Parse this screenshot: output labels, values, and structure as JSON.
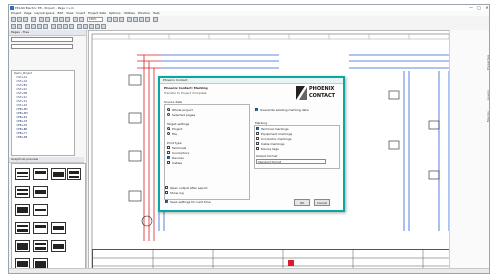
{
  "window": {
    "title": "EPLAN Electric P8 - Project - Page =+/1",
    "buttons": [
      "—",
      "□",
      "✕"
    ]
  },
  "menu": [
    "Project",
    "Page",
    "Layout space",
    "Edit",
    "View",
    "Insert",
    "Project data",
    "Options",
    "Utilities",
    "Window",
    "Help"
  ],
  "toolbar": {
    "zoom_value": "100%"
  },
  "page_navigator": {
    "title": "Pages - Tree",
    "items": [
      "Demo_Project",
      "=ST+A1",
      "=ST+A2",
      "=ST+B1",
      "=ST+K1",
      "=ST+M1",
      "=ST+S1",
      "=ST+X1",
      "=ST+X2",
      "=EB+M2",
      "=EB+M3",
      "=EB+K4",
      "=EB+X3",
      "=EB+A5",
      "=EB+B6",
      "=EB+Y7",
      "=EB+Z8"
    ]
  },
  "graphical_preview": {
    "title": "Graphical preview"
  },
  "dialog": {
    "title": "Phoenix Contact",
    "heading": "Phoenix Contact: Marking",
    "subheading": "Transfer to Project Complete",
    "sources_label": "Source data",
    "radio_all": "Whole project",
    "radio_selection": "Selected pages",
    "option_overwrite": "Overwrite existing marking data",
    "target_label": "Target settings",
    "target_project": "Project",
    "target_file": "File",
    "print_label": "Print type",
    "print_options": [
      "Terminals",
      "Conductors",
      "Devices",
      "Cables"
    ],
    "right_group_label": "Marking",
    "right_items": [
      "Terminal markings",
      "Equipment markings",
      "Conductor markings",
      "Cable markings",
      "Device tags"
    ],
    "format_label": "Output format",
    "format_value": "Standard format",
    "check_open": "Open output after export",
    "check_log": "Show log",
    "check_save": "Save settings for next time",
    "ok_label": "OK",
    "cancel_label": "Cancel",
    "logo_line1": "PHOENIX",
    "logo_line2": "CONTACT"
  },
  "right_strip": {
    "labels": [
      "Properties",
      "Layers",
      "Macros"
    ]
  },
  "colors": {
    "accent": "#0aa6a0",
    "wire_blue": "#2b63d9",
    "wire_red": "#d62020",
    "logo_red": "#d81e2a"
  }
}
